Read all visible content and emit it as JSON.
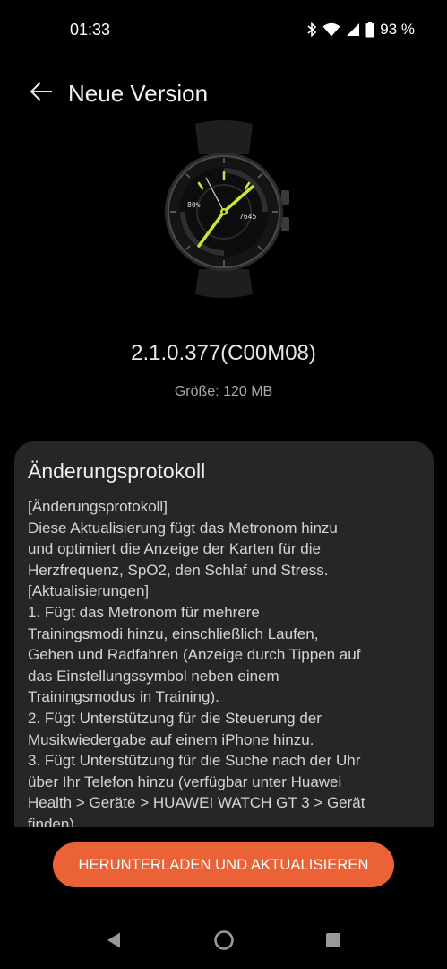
{
  "status_bar": {
    "time": "01:33",
    "battery_percent": "93 %",
    "icons": [
      "bluetooth-icon",
      "wifi-icon",
      "signal-icon",
      "battery-icon"
    ]
  },
  "header": {
    "title": "Neue Version",
    "back_icon": "arrow-left-icon"
  },
  "firmware": {
    "version": "2.1.0.377(C00M08)",
    "size": "Größe: 120 MB"
  },
  "watch_face": {
    "left_readout": "80%",
    "right_readout": "7645"
  },
  "changelog": {
    "title": "Änderungsprotokoll",
    "lines": [
      "[Änderungsprotokoll]",
      "Diese Aktualisierung fügt das Metronom hinzu",
      "und optimiert die Anzeige der Karten für die",
      "Herzfrequenz, SpO2, den Schlaf und Stress.",
      "[Aktualisierungen]",
      "1. Fügt das Metronom für mehrere",
      "Trainingsmodi hinzu, einschließlich Laufen,",
      "Gehen und Radfahren (Anzeige durch Tippen auf",
      "das Einstellungssymbol neben einem",
      "Trainingsmodus in Training).",
      "2. Fügt Unterstützung für die Steuerung der",
      "Musikwiedergabe auf einem iPhone hinzu.",
      "3. Fügt Unterstützung für die Suche nach der Uhr",
      "über Ihr Telefon hinzu (verfügbar unter Huawei",
      "Health > Geräte > HUAWEI WATCH GT 3 > Gerät",
      "finden)."
    ]
  },
  "download_button": {
    "label": "HERUNTERLADEN UND AKTUALISIEREN"
  },
  "colors": {
    "accent": "#ea6236",
    "background": "#000000",
    "card": "#262626",
    "watch_accent": "#c8e63a"
  }
}
